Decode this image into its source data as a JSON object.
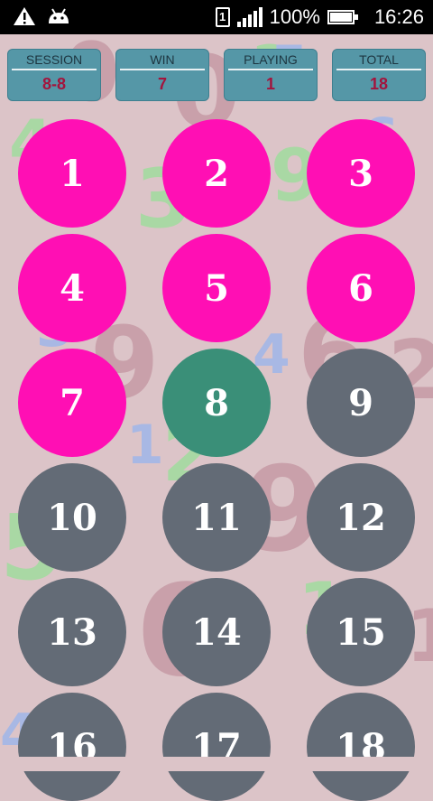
{
  "status_bar": {
    "notification_icons": [
      "warning-icon",
      "android-icon"
    ],
    "sim_label": "1",
    "battery_percent": "100%",
    "time": "16:26"
  },
  "stats": [
    {
      "label": "SESSION",
      "value": "8-8"
    },
    {
      "label": "WIN",
      "value": "7"
    },
    {
      "label": "PLAYING",
      "value": "1"
    },
    {
      "label": "TOTAL",
      "value": "18"
    }
  ],
  "numbers": [
    {
      "label": "1",
      "state": "won"
    },
    {
      "label": "2",
      "state": "won"
    },
    {
      "label": "3",
      "state": "won"
    },
    {
      "label": "4",
      "state": "won"
    },
    {
      "label": "5",
      "state": "won"
    },
    {
      "label": "6",
      "state": "won"
    },
    {
      "label": "7",
      "state": "won"
    },
    {
      "label": "8",
      "state": "playing"
    },
    {
      "label": "9",
      "state": "pending"
    },
    {
      "label": "10",
      "state": "pending"
    },
    {
      "label": "11",
      "state": "pending"
    },
    {
      "label": "12",
      "state": "pending"
    },
    {
      "label": "13",
      "state": "pending"
    },
    {
      "label": "14",
      "state": "pending"
    },
    {
      "label": "15",
      "state": "pending"
    },
    {
      "label": "16",
      "state": "pending"
    },
    {
      "label": "17",
      "state": "pending"
    },
    {
      "label": "18",
      "state": "pending"
    }
  ],
  "colors": {
    "won": "#ff0fb4",
    "playing": "#3a8f78",
    "pending": "#636b76",
    "background": "#dcc4c8",
    "stat_box": "#5597a7",
    "stat_value": "#a3143d"
  },
  "background_digits": [
    "4",
    "0",
    "0",
    "2",
    "3",
    "9",
    "6",
    "9",
    "5",
    "4",
    "6",
    "2",
    "1",
    "2",
    "9",
    "5",
    "6",
    "1",
    "1",
    "4",
    "5",
    "3"
  ]
}
